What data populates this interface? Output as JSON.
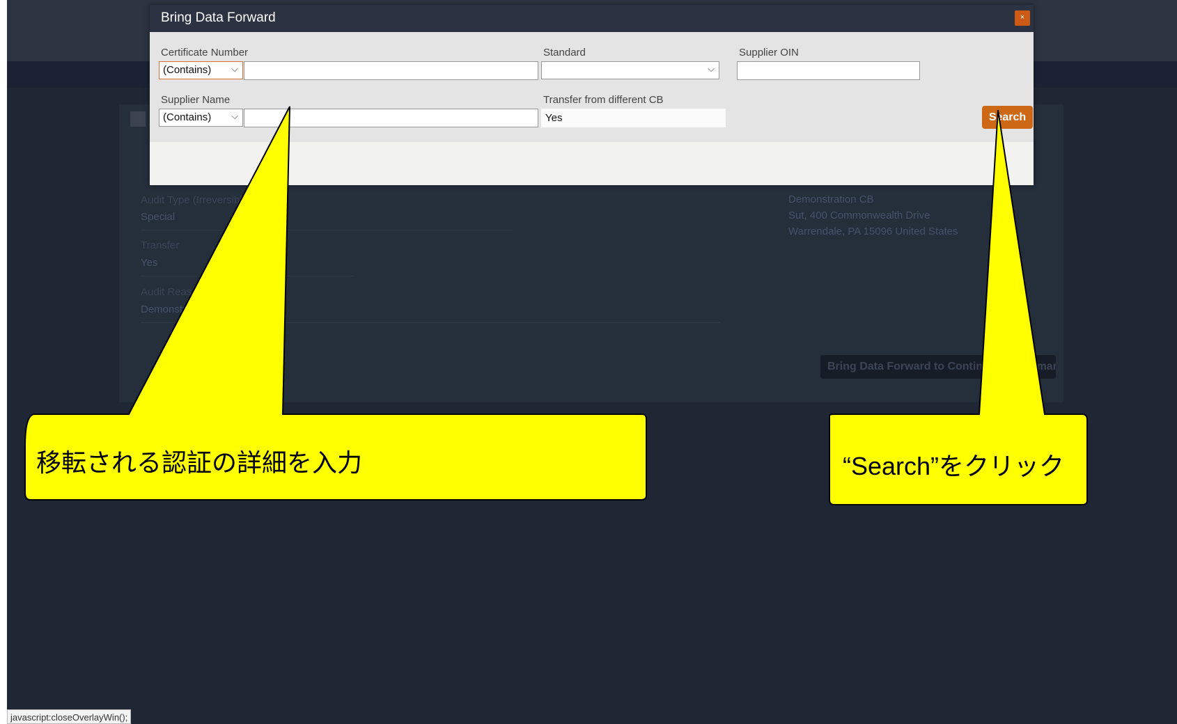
{
  "background": {
    "fields": [
      {
        "label": "Audit Type (Irreversible)",
        "value": "Special"
      },
      {
        "label": "Transfer",
        "value": "Yes"
      },
      {
        "label": "Audit Reason",
        "value": "Demonstration"
      }
    ],
    "cb_name": "Demonstration CB",
    "cb_address_1": "Sut, 400 Commonwealth Drive",
    "cb_address_2": "Warrendale, PA 15096 United States",
    "bring_forward_button": "Bring Data Forward to Continue to Summary"
  },
  "modal": {
    "title": "Bring Data Forward",
    "close_label": "×",
    "certificate_number": {
      "label": "Certificate Number",
      "operator": "(Contains)",
      "value": ""
    },
    "standard": {
      "label": "Standard",
      "value": ""
    },
    "supplier_oin": {
      "label": "Supplier OIN",
      "value": ""
    },
    "supplier_name": {
      "label": "Supplier Name",
      "operator": "(Contains)",
      "value": ""
    },
    "transfer": {
      "label": "Transfer from different CB",
      "value": "Yes"
    },
    "search_label": "Search"
  },
  "status_bar": "javascript:closeOverlayWin();",
  "callouts": {
    "left": "移転される認証の詳細を入力",
    "right": "“Search”をクリック"
  },
  "colors": {
    "accent": "#cc6816",
    "callout_fill": "#ffff00",
    "modal_header": "#2b3242"
  }
}
